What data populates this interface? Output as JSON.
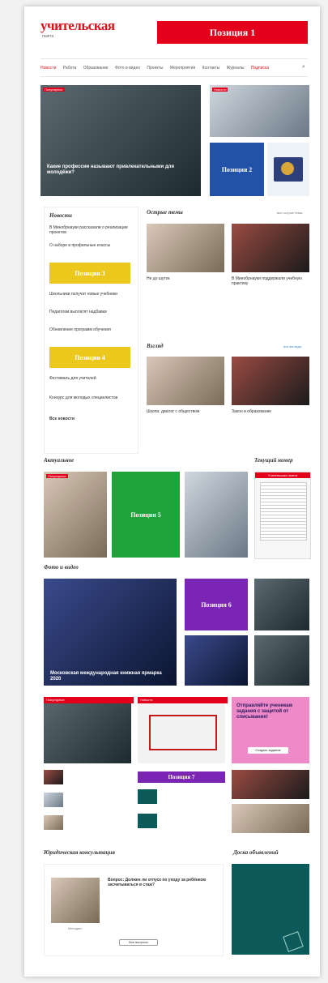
{
  "header": {
    "logo": "учительская",
    "logo_sub": "газета",
    "banner_top": "Позиция 1",
    "nav": [
      "Новости",
      "Работа",
      "Образование",
      "Фото и видео",
      "Проекты",
      "Мероприятия",
      "Контакты",
      "Журналы",
      "Подписка"
    ]
  },
  "hero": {
    "tag": "Популярное",
    "title": "Какие профессии называют привлекательными для молодёжи?",
    "side1_tag": "Новости",
    "pos2": "Позиция 2"
  },
  "news": {
    "title": "Новости",
    "items": [
      "В Минобрнауки рассказали о реализации проектов",
      "О наборе в профильные классы",
      "Школьники получат новые учебники",
      "Педагогам выплатят надбавки",
      "Обновление программ обучения",
      "Фестиваль для учителей",
      "Конкурс для молодых специалистов"
    ],
    "pos3": "Позиция 3",
    "pos4": "Позиция 4",
    "more": "Все новости"
  },
  "sharp": {
    "title": "Острые темы",
    "more": "все острые темы",
    "items": [
      "Не до шуток",
      "В Минобрнауки поддержали учебную практику"
    ]
  },
  "guest": {
    "title": "Взгляд",
    "more": "все взгляды",
    "items": [
      "Школа: диалог с обществом",
      "Закон и образование"
    ]
  },
  "actual": {
    "title": "Актуальное",
    "tag": "Популярное",
    "pos5": "Позиция 5",
    "current_title": "Текущий номер",
    "issue_label": "Учительская газета"
  },
  "photo_video": {
    "title": "Фото и видео",
    "caption": "Московская международная книжная ярмарка 2020",
    "pos6": "Позиция 6"
  },
  "cols": {
    "tag1": "Популярное",
    "tag2": "Новости",
    "pos7": "Позиция 7",
    "promo": "Отправляйте ученикам задания с защитой от списывания!",
    "promo_btn": "Создать задание"
  },
  "legal": {
    "title": "Юридическая консультация",
    "question": "Вопрос: Должен ли отпуск по уходу за ребёнком засчитываться в стаж?",
    "author": "Методист",
    "btn": "Все вопросы"
  },
  "board": {
    "title": "Доска объявлений"
  }
}
